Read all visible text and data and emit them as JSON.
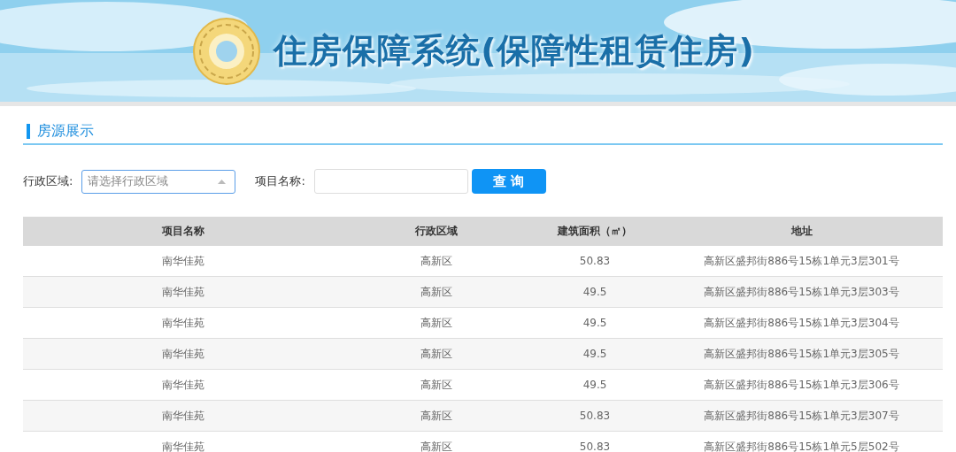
{
  "header": {
    "title": "住房保障系统(保障性租赁住房)"
  },
  "section": {
    "title": "房源展示"
  },
  "filters": {
    "district": {
      "label": "行政区域:",
      "placeholder": "请选择行政区域"
    },
    "project": {
      "label": "项目名称:"
    },
    "search_button": "查 询"
  },
  "table": {
    "columns": [
      "项目名称",
      "行政区域",
      "建筑面积（㎡）",
      "地址"
    ],
    "rows": [
      [
        "南华佳苑",
        "高新区",
        "50.83",
        "高新区盛邦街886号15栋1单元3层301号"
      ],
      [
        "南华佳苑",
        "高新区",
        "49.5",
        "高新区盛邦街886号15栋1单元3层303号"
      ],
      [
        "南华佳苑",
        "高新区",
        "49.5",
        "高新区盛邦街886号15栋1单元3层304号"
      ],
      [
        "南华佳苑",
        "高新区",
        "49.5",
        "高新区盛邦街886号15栋1单元3层305号"
      ],
      [
        "南华佳苑",
        "高新区",
        "49.5",
        "高新区盛邦街886号15栋1单元3层306号"
      ],
      [
        "南华佳苑",
        "高新区",
        "50.83",
        "高新区盛邦街886号15栋1单元3层307号"
      ],
      [
        "南华佳苑",
        "高新区",
        "50.83",
        "高新区盛邦街886号15栋1单元5层502号"
      ]
    ]
  }
}
